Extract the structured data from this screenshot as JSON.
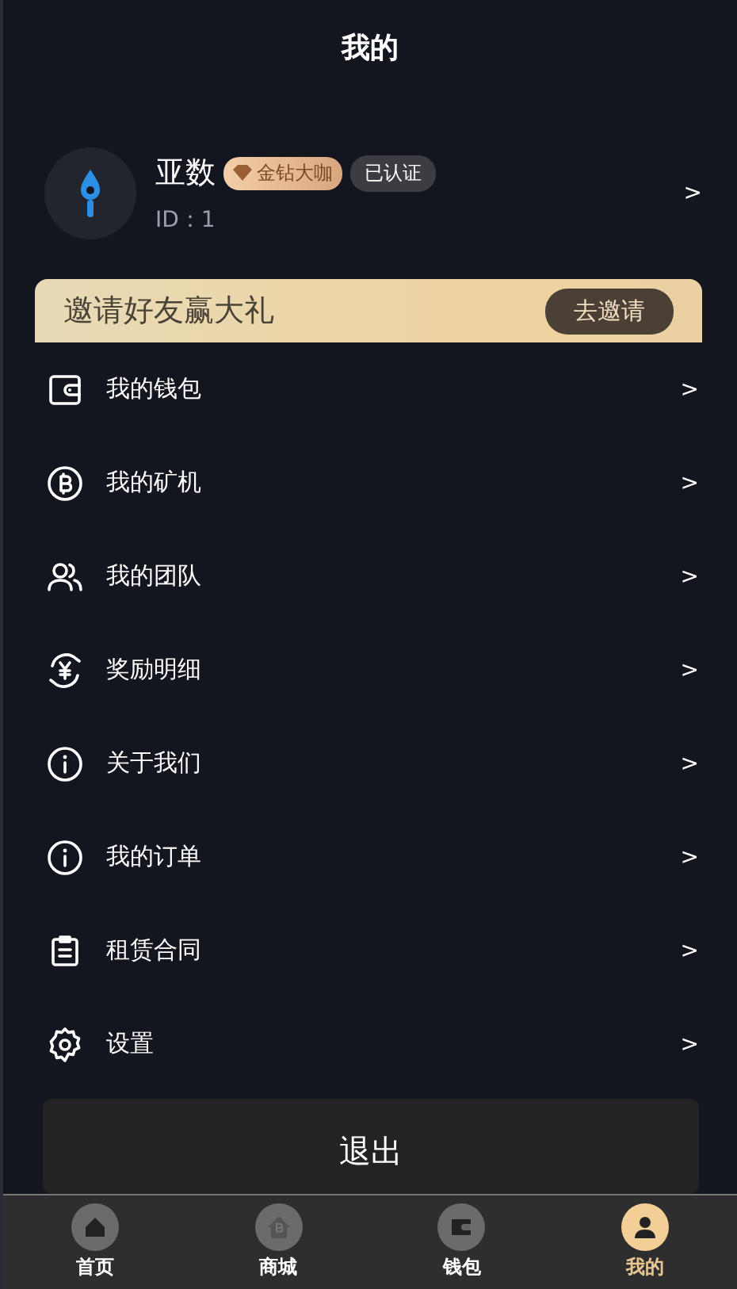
{
  "header": {
    "title": "我的"
  },
  "profile": {
    "name": "亚数",
    "level_badge": "金钻大咖",
    "verified_badge": "已认证",
    "id_text": "ID：1",
    "chevron": ">"
  },
  "invite_banner": {
    "text": "邀请好友赢大礼",
    "button": "去邀请"
  },
  "menu": [
    {
      "kind": "wallet",
      "label": "我的钱包",
      "chevron": ">"
    },
    {
      "kind": "coin",
      "label": "我的矿机",
      "chevron": ">"
    },
    {
      "kind": "team",
      "label": "我的团队",
      "chevron": ">"
    },
    {
      "kind": "reward",
      "label": "奖励明细",
      "chevron": ">"
    },
    {
      "kind": "info",
      "label": "关于我们",
      "chevron": ">"
    },
    {
      "kind": "info",
      "label": "我的订单",
      "chevron": ">"
    },
    {
      "kind": "clipboard",
      "label": "租赁合同",
      "chevron": ">"
    },
    {
      "kind": "gear",
      "label": "设置",
      "chevron": ">"
    }
  ],
  "logout_button": "退出",
  "tab_bar": [
    {
      "kind": "home",
      "label": "首页",
      "selected": false
    },
    {
      "kind": "shop",
      "label": "商城",
      "selected": false
    },
    {
      "kind": "wallet",
      "label": "钱包",
      "selected": false
    },
    {
      "kind": "user",
      "label": "我的",
      "selected": true
    }
  ]
}
